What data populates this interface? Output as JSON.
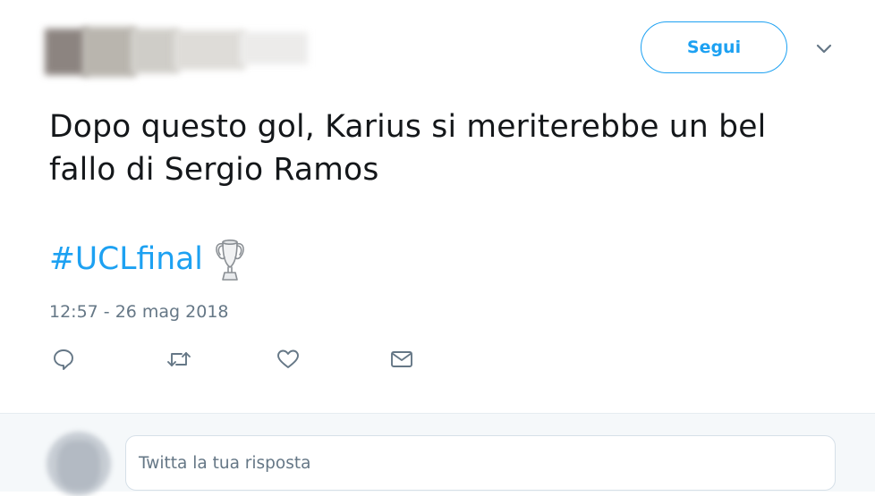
{
  "header": {
    "follow_label": "Segui"
  },
  "tweet": {
    "text_line1": "Dopo questo gol, Karius si meriterebbe un bel",
    "text_line2": "fallo di Sergio Ramos",
    "hashtag": "#UCLfinal",
    "emoji_name": "trophy-icon",
    "timestamp": "12:57 - 26 mag 2018"
  },
  "actions": [
    {
      "name": "reply-icon"
    },
    {
      "name": "retweet-icon"
    },
    {
      "name": "like-icon"
    },
    {
      "name": "direct-message-icon"
    }
  ],
  "reply": {
    "placeholder": "Twitta la tua risposta"
  },
  "colors": {
    "accent": "#1da1f2",
    "text": "#14171a",
    "muted": "#657786",
    "reply_bg": "#f5f8fa"
  }
}
